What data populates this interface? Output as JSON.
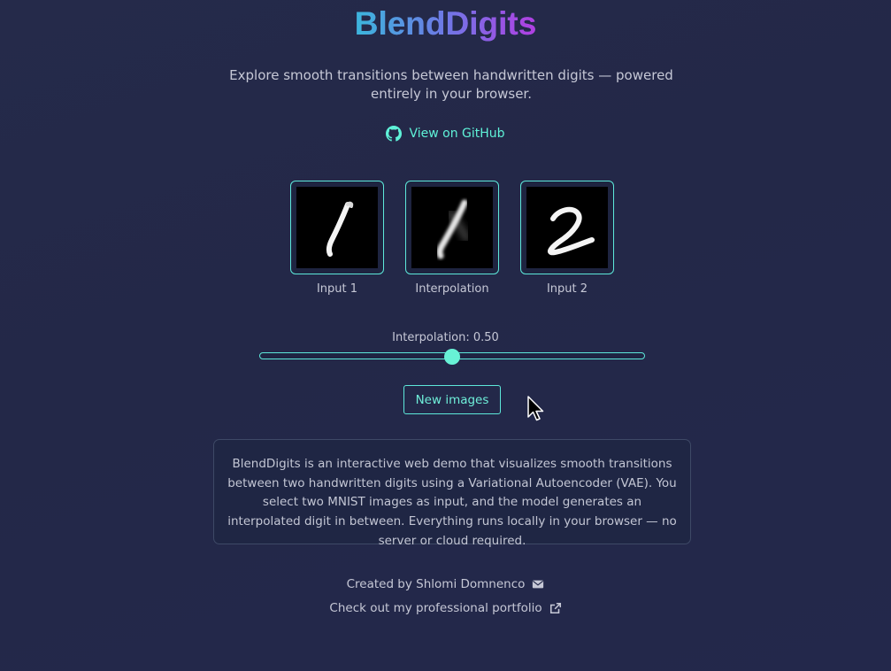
{
  "header": {
    "title": "BlendDigits",
    "subtitle": "Explore smooth transitions between handwritten digits — powered entirely in your browser.",
    "github_link": "View on GitHub"
  },
  "digits": [
    {
      "label": "Input 1",
      "digit": "1"
    },
    {
      "label": "Interpolation",
      "digit": "1"
    },
    {
      "label": "Input 2",
      "digit": "2"
    }
  ],
  "slider": {
    "label": "Interpolation: 0.50",
    "value": 0.5
  },
  "new_images_button": "New images",
  "about": "BlendDigits is an interactive web demo that visualizes smooth transitions between two handwritten digits using a Variational Autoencoder (VAE). You select two MNIST images as input, and the model generates an interpolated digit in between. Everything runs locally in your browser — no server or cloud required.",
  "footer": {
    "created_by": "Created by Shlomi Domnenco",
    "portfolio": "Check out my professional portfolio"
  },
  "icons": {
    "github": "github-icon",
    "email": "envelope-icon",
    "external": "external-link-icon",
    "cursor": "mouse-pointer-icon"
  },
  "colors": {
    "accent": "#5de8da",
    "background": "#242a4a",
    "title_gradient_start": "#3bb6dc",
    "title_gradient_end": "#b23ee2"
  }
}
